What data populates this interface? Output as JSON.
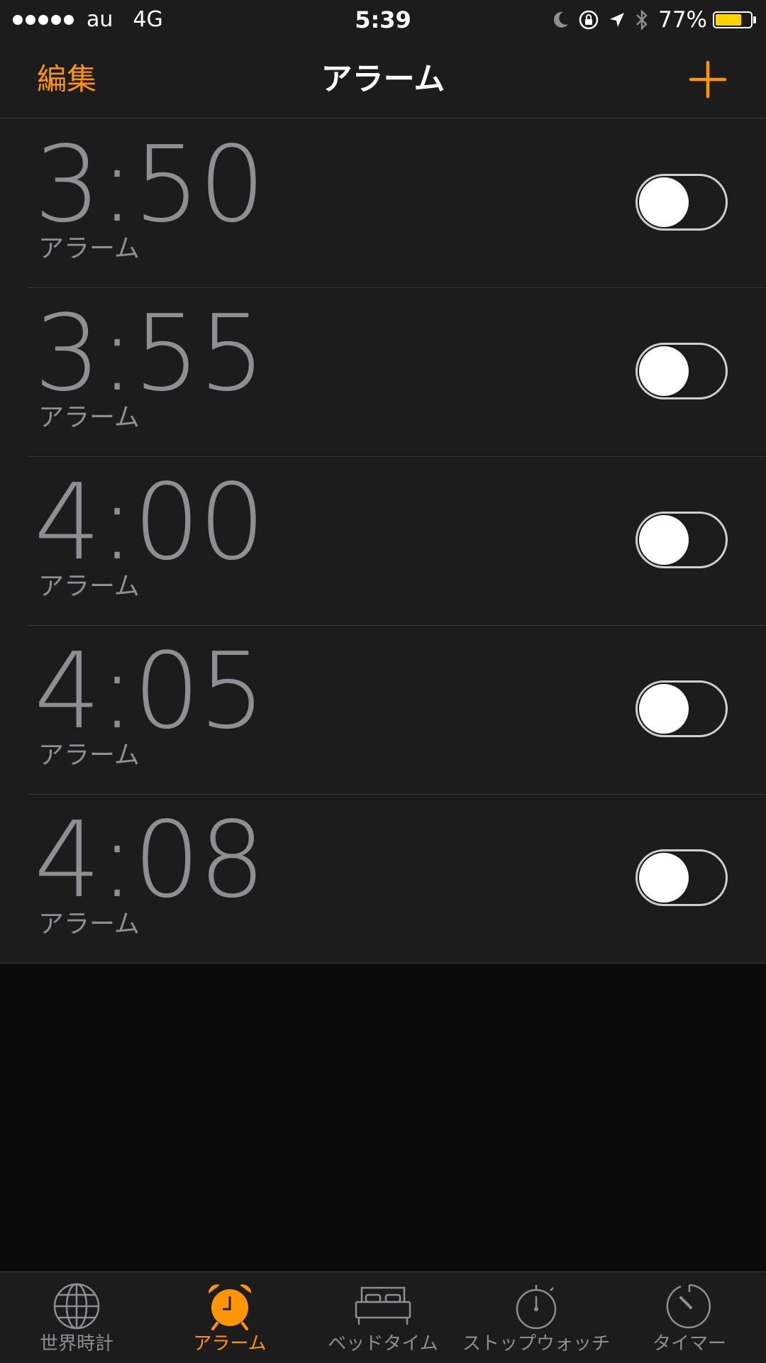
{
  "status": {
    "carrier": "au",
    "network": "4G",
    "time": "5:39",
    "battery_percent": "77%",
    "battery_level": 0.77,
    "signal_dots": 5
  },
  "nav": {
    "edit_label": "編集",
    "title": "アラーム",
    "add_icon": "plus-icon"
  },
  "alarms": [
    {
      "time": "3:50",
      "label": "アラーム",
      "enabled": false
    },
    {
      "time": "3:55",
      "label": "アラーム",
      "enabled": false
    },
    {
      "time": "4:00",
      "label": "アラーム",
      "enabled": false
    },
    {
      "time": "4:05",
      "label": "アラーム",
      "enabled": false
    },
    {
      "time": "4:08",
      "label": "アラーム",
      "enabled": false
    }
  ],
  "tabs": [
    {
      "label": "世界時計",
      "icon": "globe-icon",
      "active": false
    },
    {
      "label": "アラーム",
      "icon": "alarm-clock-icon",
      "active": true
    },
    {
      "label": "ベッドタイム",
      "icon": "bed-icon",
      "active": false
    },
    {
      "label": "ストップウォッチ",
      "icon": "stopwatch-icon",
      "active": false
    },
    {
      "label": "タイマー",
      "icon": "timer-icon",
      "active": false
    }
  ],
  "colors": {
    "accent": "#ff9500",
    "time_text": "#8e8e93",
    "battery": "#ffd200"
  }
}
